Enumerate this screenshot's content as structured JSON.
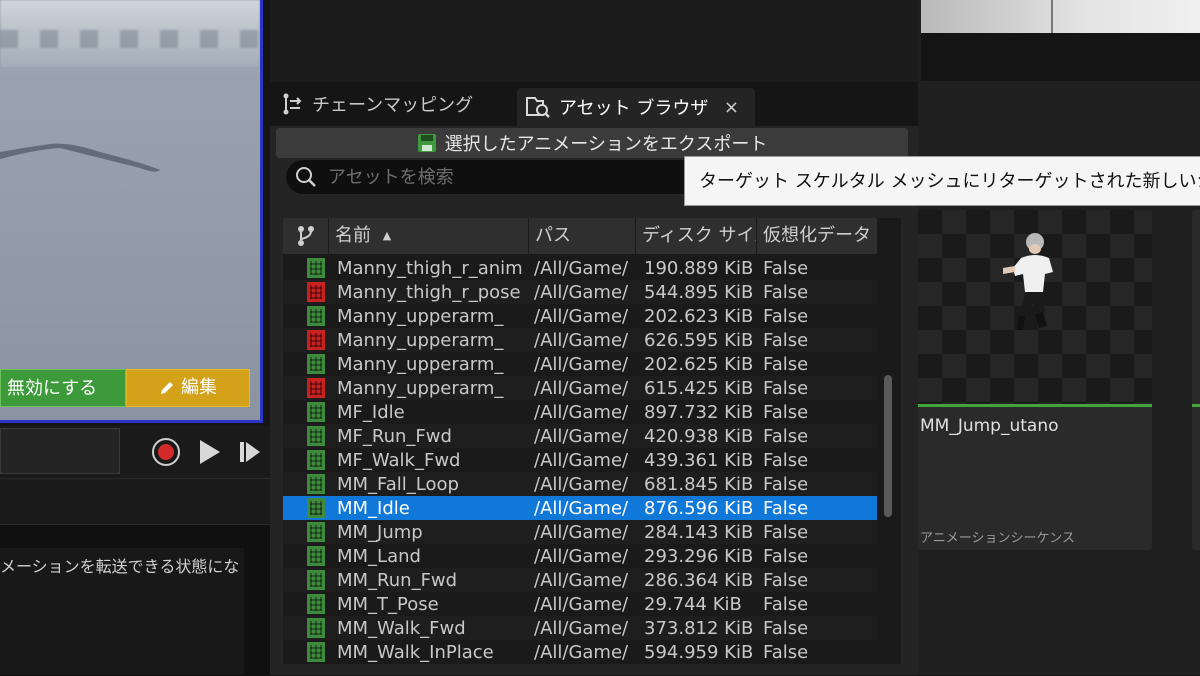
{
  "left": {
    "disable_button": "無効にする",
    "edit_button": "編集",
    "status_text": "メーションを転送できる状態にな"
  },
  "tabs": [
    {
      "label": "チェーンマッピング"
    },
    {
      "label": "アセット ブラウザ",
      "close": "×"
    }
  ],
  "toolbar": {
    "export_label": "選択したアニメーションをエクスポート"
  },
  "search": {
    "placeholder": "アセットを検索"
  },
  "tooltip": {
    "text": "ターゲット スケルタル メッシュにリターゲットされた新しいシーケン"
  },
  "table": {
    "columns": [
      "名前",
      "パス",
      "ディスク サイズ",
      "仮想化データ"
    ],
    "sort_indicator": "▲",
    "rows": [
      {
        "icon": "green",
        "name": "Manny_thigh_r_anim",
        "path": "/All/Game/",
        "size": "190.889 KiB",
        "virtualized": "False"
      },
      {
        "icon": "red",
        "name": "Manny_thigh_r_pose",
        "path": "/All/Game/",
        "size": "544.895 KiB",
        "virtualized": "False"
      },
      {
        "icon": "green",
        "name": "Manny_upperarm_",
        "path": "/All/Game/",
        "size": "202.623 KiB",
        "virtualized": "False"
      },
      {
        "icon": "red",
        "name": "Manny_upperarm_",
        "path": "/All/Game/",
        "size": "626.595 KiB",
        "virtualized": "False"
      },
      {
        "icon": "green",
        "name": "Manny_upperarm_",
        "path": "/All/Game/",
        "size": "202.625 KiB",
        "virtualized": "False"
      },
      {
        "icon": "red",
        "name": "Manny_upperarm_",
        "path": "/All/Game/",
        "size": "615.425 KiB",
        "virtualized": "False"
      },
      {
        "icon": "green",
        "name": "MF_Idle",
        "path": "/All/Game/",
        "size": "897.732 KiB",
        "virtualized": "False"
      },
      {
        "icon": "green",
        "name": "MF_Run_Fwd",
        "path": "/All/Game/",
        "size": "420.938 KiB",
        "virtualized": "False"
      },
      {
        "icon": "green",
        "name": "MF_Walk_Fwd",
        "path": "/All/Game/",
        "size": "439.361 KiB",
        "virtualized": "False"
      },
      {
        "icon": "green",
        "name": "MM_Fall_Loop",
        "path": "/All/Game/",
        "size": "681.845 KiB",
        "virtualized": "False"
      },
      {
        "icon": "green",
        "name": "MM_Idle",
        "path": "/All/Game/",
        "size": "876.596 KiB",
        "virtualized": "False",
        "selected": true
      },
      {
        "icon": "green",
        "name": "MM_Jump",
        "path": "/All/Game/",
        "size": "284.143 KiB",
        "virtualized": "False"
      },
      {
        "icon": "green",
        "name": "MM_Land",
        "path": "/All/Game/",
        "size": "293.296 KiB",
        "virtualized": "False"
      },
      {
        "icon": "green",
        "name": "MM_Run_Fwd",
        "path": "/All/Game/",
        "size": "286.364 KiB",
        "virtualized": "False"
      },
      {
        "icon": "green",
        "name": "MM_T_Pose",
        "path": "/All/Game/",
        "size": "29.744 KiB",
        "virtualized": "False"
      },
      {
        "icon": "green",
        "name": "MM_Walk_Fwd",
        "path": "/All/Game/",
        "size": "373.812 KiB",
        "virtualized": "False"
      },
      {
        "icon": "green",
        "name": "MM_Walk_InPlace",
        "path": "/All/Game/",
        "size": "594.959 KiB",
        "virtualized": "False"
      }
    ]
  },
  "asset_card": {
    "title": "MM_Jump_utano",
    "type": "アニメーションシーケンス"
  },
  "colors": {
    "accent_selected": "#0f78d8",
    "icon_green": "#3f8a3f",
    "icon_red": "#c92020",
    "disable_green": "#3d9a3a",
    "edit_yellow": "#d3a218",
    "viewport_border": "#2c35c8"
  },
  "icons": {
    "tab1": "chain-mapping-icon",
    "tab2": "asset-browser-icon",
    "export": "save-icon",
    "search": "search-icon",
    "column_filter": "branch-icon",
    "edit": "pencil-icon"
  }
}
